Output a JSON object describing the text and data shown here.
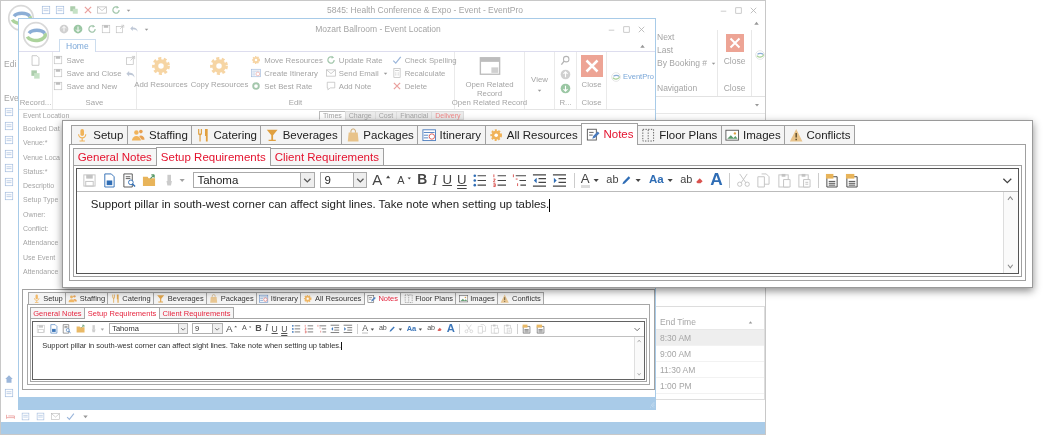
{
  "main_window": {
    "title": "5845: Health Conference & Expo - Event - EventPro",
    "left_labels": [
      "Edi",
      "Eve"
    ],
    "navigation": {
      "items": [
        "Next",
        "Last",
        "By Booking #"
      ],
      "group_label": "Navigation"
    },
    "close": {
      "label": "Close",
      "group_label": "Close"
    },
    "grid": {
      "columns": [
        "End Time"
      ],
      "rows": [
        "8:30 AM",
        "9:00 AM",
        "11:30 AM",
        "1:00 PM"
      ]
    }
  },
  "inner_window": {
    "title": "Mozart Ballroom - Event Location",
    "ribbon_tabs": [
      {
        "label": "Home",
        "selected": true
      }
    ],
    "ribbon_groups": [
      {
        "label": "Record...",
        "columns": [
          [
            {
              "kind": "icon"
            },
            {
              "kind": "icon"
            }
          ]
        ]
      },
      {
        "label": "Save",
        "columns": [
          [
            {
              "kind": "small",
              "label": "Save"
            },
            {
              "kind": "small",
              "label": "Save and Close"
            },
            {
              "kind": "small",
              "label": "Save and New"
            }
          ],
          [
            {
              "kind": "icon"
            },
            {
              "kind": "icon"
            }
          ]
        ]
      },
      {
        "label": "Edit",
        "columns": [
          [
            {
              "kind": "large",
              "label": "Add Resources"
            }
          ],
          [
            {
              "kind": "large",
              "label": "Copy Resources"
            }
          ],
          [
            {
              "kind": "small",
              "label": "Move Resources"
            },
            {
              "kind": "small",
              "label": "Create Itinerary"
            },
            {
              "kind": "small",
              "label": "Set Best Rate"
            }
          ],
          [
            {
              "kind": "small",
              "label": "Update Rate"
            },
            {
              "kind": "split",
              "label": "Send Email"
            },
            {
              "kind": "small",
              "label": "Add Note"
            }
          ],
          [
            {
              "kind": "small",
              "label": "Check Spelling"
            },
            {
              "kind": "small",
              "label": "Recalculate"
            },
            {
              "kind": "small",
              "label": "Delete"
            }
          ]
        ]
      },
      {
        "label": "Open Related Record",
        "columns": [
          [
            {
              "kind": "large",
              "label": "Open Related Record"
            }
          ]
        ]
      },
      {
        "columns": [
          [
            {
              "kind": "menu",
              "label": "View"
            }
          ]
        ]
      },
      {
        "label": "R...",
        "columns": [
          [
            {
              "kind": "icon"
            },
            {
              "kind": "icon"
            },
            {
              "kind": "icon"
            }
          ]
        ]
      },
      {
        "label": "Close",
        "columns": [
          [
            {
              "kind": "close",
              "label": "Close"
            }
          ]
        ]
      }
    ],
    "logo_text": "EventPro",
    "form": {
      "group_title": "Event Location",
      "labels": [
        "Booked Dat",
        "Venue:*",
        "Venue Loca",
        "Status:*",
        "Descriptio",
        "Setup Type",
        "Owner:",
        "Conflict:",
        "Attendance",
        "Use Event",
        "Attendance"
      ]
    },
    "detail_tabs": [
      {
        "label": "Times",
        "selected": true,
        "flagged": false
      },
      {
        "label": "Charge",
        "selected": false,
        "flagged": false
      },
      {
        "label": "Cost",
        "selected": false,
        "flagged": false
      },
      {
        "label": "Financial",
        "selected": false,
        "flagged": false
      },
      {
        "label": "Delivery",
        "selected": false,
        "flagged": true
      }
    ],
    "notes": {
      "tabs": [
        {
          "label": "Setup",
          "selected": false,
          "flagged": false
        },
        {
          "label": "Staffing",
          "selected": false,
          "flagged": false
        },
        {
          "label": "Catering",
          "selected": false,
          "flagged": false
        },
        {
          "label": "Beverages",
          "selected": false,
          "flagged": false
        },
        {
          "label": "Packages",
          "selected": false,
          "flagged": false
        },
        {
          "label": "Itinerary",
          "selected": false,
          "flagged": false
        },
        {
          "label": "All Resources",
          "selected": false,
          "flagged": false
        },
        {
          "label": "Notes",
          "selected": true,
          "flagged": true
        },
        {
          "label": "Floor Plans",
          "selected": false,
          "flagged": false
        },
        {
          "label": "Images",
          "selected": false,
          "flagged": false
        },
        {
          "label": "Conflicts",
          "selected": false,
          "flagged": false
        }
      ],
      "subtabs": [
        {
          "label": "General Notes",
          "selected": false,
          "flagged": true
        },
        {
          "label": "Setup Requirements",
          "selected": true,
          "flagged": true
        },
        {
          "label": "Client Requirements",
          "selected": false,
          "flagged": true
        }
      ],
      "toolbar": [
        [
          {
            "kind": "save",
            "disabled": true
          },
          {
            "kind": "word",
            "disabled": false
          },
          {
            "kind": "preview",
            "disabled": false
          },
          {
            "kind": "folder",
            "disabled": false
          },
          {
            "kind": "brush",
            "disabled": true
          },
          {
            "kind": "font",
            "value": "Tahoma",
            "disabled": false
          },
          {
            "kind": "size",
            "value": "9",
            "disabled": false
          },
          {
            "kind": "grow",
            "label": "A",
            "disabled": false
          },
          {
            "kind": "shrink",
            "label": "A",
            "disabled": false
          },
          {
            "kind": "bold",
            "label": "B",
            "disabled": false
          },
          {
            "kind": "italic",
            "label": "I",
            "disabled": false
          },
          {
            "kind": "underline",
            "label": "U",
            "disabled": false
          },
          {
            "kind": "double",
            "label": "U",
            "disabled": false
          },
          {
            "kind": "bullets",
            "disabled": false
          },
          {
            "kind": "numbering",
            "disabled": false
          },
          {
            "kind": "multilevel",
            "disabled": false
          },
          {
            "kind": "outdent",
            "disabled": false
          },
          {
            "kind": "indent",
            "disabled": false
          }
        ],
        [
          {
            "kind": "fontcolor",
            "label": "A",
            "disabled": false
          },
          {
            "kind": "highlight",
            "label": "ab",
            "disabled": false
          },
          {
            "kind": "case",
            "label": "Aa",
            "disabled": false
          },
          {
            "kind": "clear",
            "label": "ab",
            "disabled": false
          },
          {
            "kind": "bigfont",
            "label": "A",
            "disabled": false
          }
        ],
        [
          {
            "kind": "cut",
            "disabled": true
          },
          {
            "kind": "copy",
            "disabled": true
          },
          {
            "kind": "paste",
            "disabled": true
          },
          {
            "kind": "pastespecial",
            "disabled": true
          }
        ],
        [
          {
            "kind": "fieldcode",
            "disabled": false
          },
          {
            "kind": "mergefield",
            "disabled": false
          }
        ]
      ],
      "text": "Support pillar in south-west corner can affect sight lines. Take note when setting up tables."
    }
  },
  "callout": {
    "notes": {
      "tabs": [
        {
          "label": "Setup",
          "selected": false,
          "flagged": false
        },
        {
          "label": "Staffing",
          "selected": false,
          "flagged": false
        },
        {
          "label": "Catering",
          "selected": false,
          "flagged": false
        },
        {
          "label": "Beverages",
          "selected": false,
          "flagged": false
        },
        {
          "label": "Packages",
          "selected": false,
          "flagged": false
        },
        {
          "label": "Itinerary",
          "selected": false,
          "flagged": false
        },
        {
          "label": "All Resources",
          "selected": false,
          "flagged": false
        },
        {
          "label": "Notes",
          "selected": true,
          "flagged": true
        },
        {
          "label": "Floor Plans",
          "selected": false,
          "flagged": false
        },
        {
          "label": "Images",
          "selected": false,
          "flagged": false
        },
        {
          "label": "Conflicts",
          "selected": false,
          "flagged": false
        }
      ],
      "subtabs": [
        {
          "label": "General Notes",
          "selected": false,
          "flagged": true
        },
        {
          "label": "Setup Requirements",
          "selected": true,
          "flagged": true
        },
        {
          "label": "Client Requirements",
          "selected": false,
          "flagged": true
        }
      ],
      "toolbar": [
        [
          {
            "kind": "save",
            "disabled": true
          },
          {
            "kind": "word",
            "disabled": false
          },
          {
            "kind": "preview",
            "disabled": false
          },
          {
            "kind": "folder",
            "disabled": false
          },
          {
            "kind": "brush",
            "disabled": true
          },
          {
            "kind": "font",
            "value": "Tahoma",
            "disabled": false
          },
          {
            "kind": "size",
            "value": "9",
            "disabled": false
          },
          {
            "kind": "grow",
            "label": "A",
            "disabled": false
          },
          {
            "kind": "shrink",
            "label": "A",
            "disabled": false
          },
          {
            "kind": "bold",
            "label": "B",
            "disabled": false
          },
          {
            "kind": "italic",
            "label": "I",
            "disabled": false
          },
          {
            "kind": "underline",
            "label": "U",
            "disabled": false
          },
          {
            "kind": "double",
            "label": "U",
            "disabled": false
          },
          {
            "kind": "bullets",
            "disabled": false
          },
          {
            "kind": "numbering",
            "disabled": false
          },
          {
            "kind": "multilevel",
            "disabled": false
          },
          {
            "kind": "outdent",
            "disabled": false
          },
          {
            "kind": "indent",
            "disabled": false
          }
        ],
        [
          {
            "kind": "fontcolor",
            "label": "A",
            "disabled": false
          },
          {
            "kind": "highlight",
            "label": "ab",
            "disabled": false
          },
          {
            "kind": "case",
            "label": "Aa",
            "disabled": false
          },
          {
            "kind": "clear",
            "label": "ab",
            "disabled": false
          },
          {
            "kind": "bigfont",
            "label": "A",
            "disabled": false
          }
        ],
        [
          {
            "kind": "cut",
            "disabled": true
          },
          {
            "kind": "copy",
            "disabled": true
          },
          {
            "kind": "paste",
            "disabled": true
          },
          {
            "kind": "pastespecial",
            "disabled": true
          }
        ],
        [
          {
            "kind": "fieldcode",
            "disabled": false
          },
          {
            "kind": "mergefield",
            "disabled": false
          }
        ]
      ],
      "text": "Support pillar in south-west corner can affect sight lines. Take note when setting up tables."
    }
  }
}
